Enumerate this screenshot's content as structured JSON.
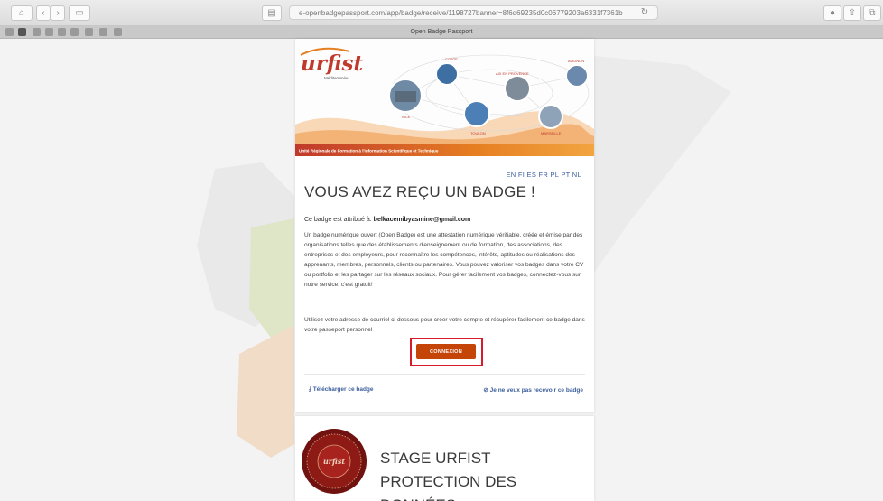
{
  "browser": {
    "url": "e-openbadgepassport.com/app/badge/receive/1198727banner=8f6d69235d0c06779203a6331f7361b",
    "tab_title": "Open Badge Passport"
  },
  "banner": {
    "logo_text": "urfist",
    "logo_sub": "Méditerranée",
    "cities": [
      "CORTE",
      "AIX EN PROVENCE",
      "AVIGNON",
      "NICE",
      "TOULON",
      "MARSEILLE"
    ],
    "footer": "Unité Régionale de Formation à l'Information Scientifique et Technique"
  },
  "languages": "EN FI ES FR PL PT NL",
  "main": {
    "title": "VOUS AVEZ REÇU UN BADGE !",
    "recipient_prefix": "Ce badge est attribué à:",
    "recipient_email": "belkacemibyasmine@gmail.com",
    "description": "Un badge numérique ouvert (Open Badge) est une attestation numérique vérifiable, créée et émise par des organisations telles que des établissements d'enseignement ou de formation, des associations, des entreprises et des employeurs, pour reconnaître les compétences, intérêts, aptitudes ou réalisations des apprenants, membres, personnels, clients ou partenaires. Vous pouvez valoriser vos badges dans votre CV ou portfolio et les partager sur les réseaux sociaux. Pour gérer facilement vos badges, connectez-vous sur notre service, c'est gratuit!",
    "instruction": "Utilisez votre adresse de courriel ci-dessous pour créer votre compte et récupérer facilement ce badge dans votre passeport personnel",
    "connect_label": "CONNEXION",
    "download_label": "Télécharger ce badge",
    "decline_label": "Je ne veux pas recevoir ce badge"
  },
  "badge": {
    "title": "STAGE URFIST PROTECTION DES DONNÉES",
    "seal_text": "urfist"
  },
  "colors": {
    "accent": "#c54408",
    "highlight": "#d81b2a",
    "link": "#3b5e9c",
    "badge_red": "#8e1a16"
  }
}
